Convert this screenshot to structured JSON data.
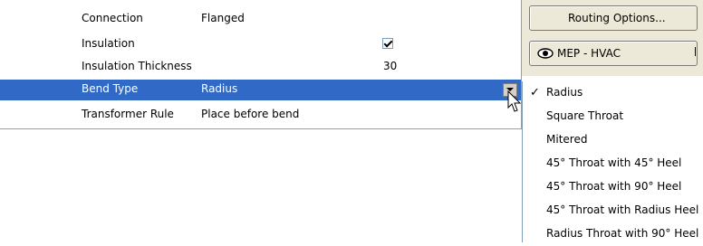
{
  "properties": [
    {
      "name": "Connection",
      "value": "Flanged"
    },
    {
      "name": "Insulation",
      "value": "",
      "checked": true
    },
    {
      "name": "Insulation Thickness",
      "value": "",
      "number": "30"
    },
    {
      "name": "Bend Type",
      "value": "Radius",
      "selected": true
    },
    {
      "name": "Transformer Rule",
      "value": "Place before bend"
    }
  ],
  "buttons": {
    "routing_label": "Routing Options...",
    "mep_label": "MEP - HVAC"
  },
  "dropdown": {
    "options": [
      "Radius",
      "Square Throat",
      "Mitered",
      "45° Throat with 45° Heel",
      "45° Throat with 90° Heel",
      "45° Throat with Radius Heel",
      "Radius Throat with 90° Heel"
    ],
    "selected_index": 0,
    "check_glyph": "✓"
  },
  "colors": {
    "selection": "#3169c6",
    "panel": "#ece9d8"
  }
}
